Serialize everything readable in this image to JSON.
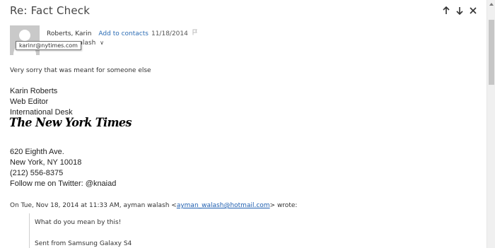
{
  "message": {
    "subject": "Re: Fact Check",
    "sender_name": "Roberts, Karin",
    "add_to_contacts": "Add to contacts",
    "date": "11/18/2014",
    "to_partial": "walash",
    "to_chevron": "∨",
    "tooltip_email": "karinr@nytimes.com"
  },
  "nav": {
    "up_icon": "arrow-up-icon",
    "down_icon": "arrow-down-icon",
    "close_icon": "close-icon"
  },
  "body": {
    "intro": "Very sorry that was meant for someone else",
    "signature": {
      "name": "Karin Roberts",
      "title": "Web Editor",
      "desk": "International Desk",
      "logo_text": "The New York Times",
      "address1": "620 Eighth Ave.",
      "address2": "New York, NY 10018",
      "phone": "(212) 556-8375",
      "twitter": "Follow me on Twitter: @knaiad"
    },
    "quote_header_pre": "On Tue, Nov 18, 2014 at 11:33 AM, ayman walash <",
    "quote_header_email": "ayman_walash@hotmail.com",
    "quote_header_post": "> wrote:",
    "quoted_line1": "What do you mean by this!",
    "quoted_line2": "Sent from Samsung Galaxy S4"
  },
  "colors": {
    "link": "#2b6cb4",
    "avatar_bg": "#c9c9c9",
    "scroll_thumb": "#c6c6c6"
  }
}
